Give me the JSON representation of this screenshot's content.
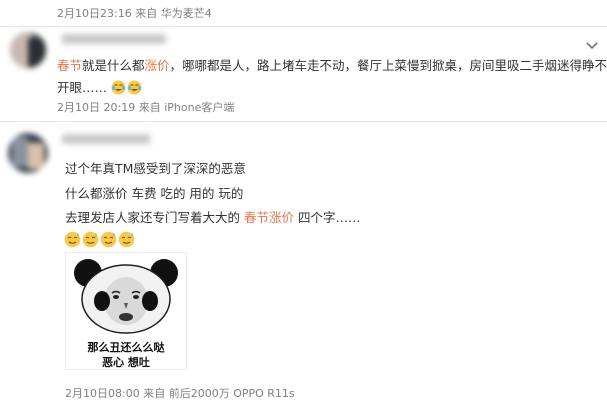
{
  "post0": {
    "date": "2月10日23:16",
    "via": "来自",
    "device": "华为麦芒4"
  },
  "comment1": {
    "keyword1": "春节",
    "text_a": "就是什么都",
    "keyword2": "涨价",
    "text_b": "，哪哪都是人，路上堵车走不动，餐厅上菜慢到掀桌，房间里吸二手烟迷得睁不",
    "text_c": "开眼……",
    "date": "2月10日 20:19",
    "via": "来自",
    "device": "iPhone客户端"
  },
  "comment2": {
    "line1": "过个年真TM感受到了深深的恶意",
    "line2": "什么都涨价 车费 吃的 用的 玩的",
    "line3_a": "去理发店人家还专门写着大大的 ",
    "line3_keyword": "春节涨价",
    "line3_b": " 四个字……",
    "sticker_caption1": "那么丑还么么哒",
    "sticker_caption2": "恶心  想吐",
    "date": "2月10日08:00",
    "via": "来自",
    "device": "前后2000万 OPPO R11s"
  },
  "colors": {
    "keyword": "#eb7350",
    "meta": "#808080",
    "separator": "#e6e6e6"
  },
  "icons": [
    "chevron-down-icon",
    "crying-laughing-emoji",
    "sweat-emoji"
  ]
}
